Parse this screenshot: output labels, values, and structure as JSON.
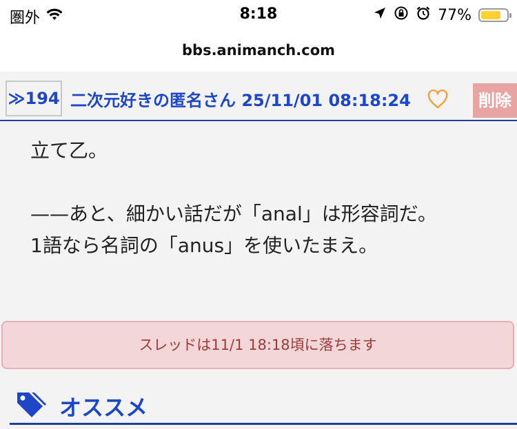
{
  "status_bar": {
    "carrier": "圏外",
    "time": "8:18",
    "battery_percent": "77%",
    "battery_level": 0.77
  },
  "url_bar": {
    "domain": "bbs.animanch.com"
  },
  "post": {
    "number_label": "≫194",
    "poster_name": "二次元好きの匿名さん",
    "timestamp": "25/11/01 08:18:24",
    "delete_label": "削除",
    "lines": [
      "立て乙。",
      "",
      "——あと、細かい話だが「anal」は形容詞だ。",
      "1語なら名詞の「anus」を使いたまえ。"
    ]
  },
  "thread_notice": "スレッドは11/1 18:18頃に落ちます",
  "recommend": {
    "title": "オススメ"
  },
  "colors": {
    "link_blue": "#1d47c7",
    "delete_bg": "#e8a3a3",
    "notice_bg": "#f3d6d8",
    "heart_orange": "#f0a040"
  }
}
